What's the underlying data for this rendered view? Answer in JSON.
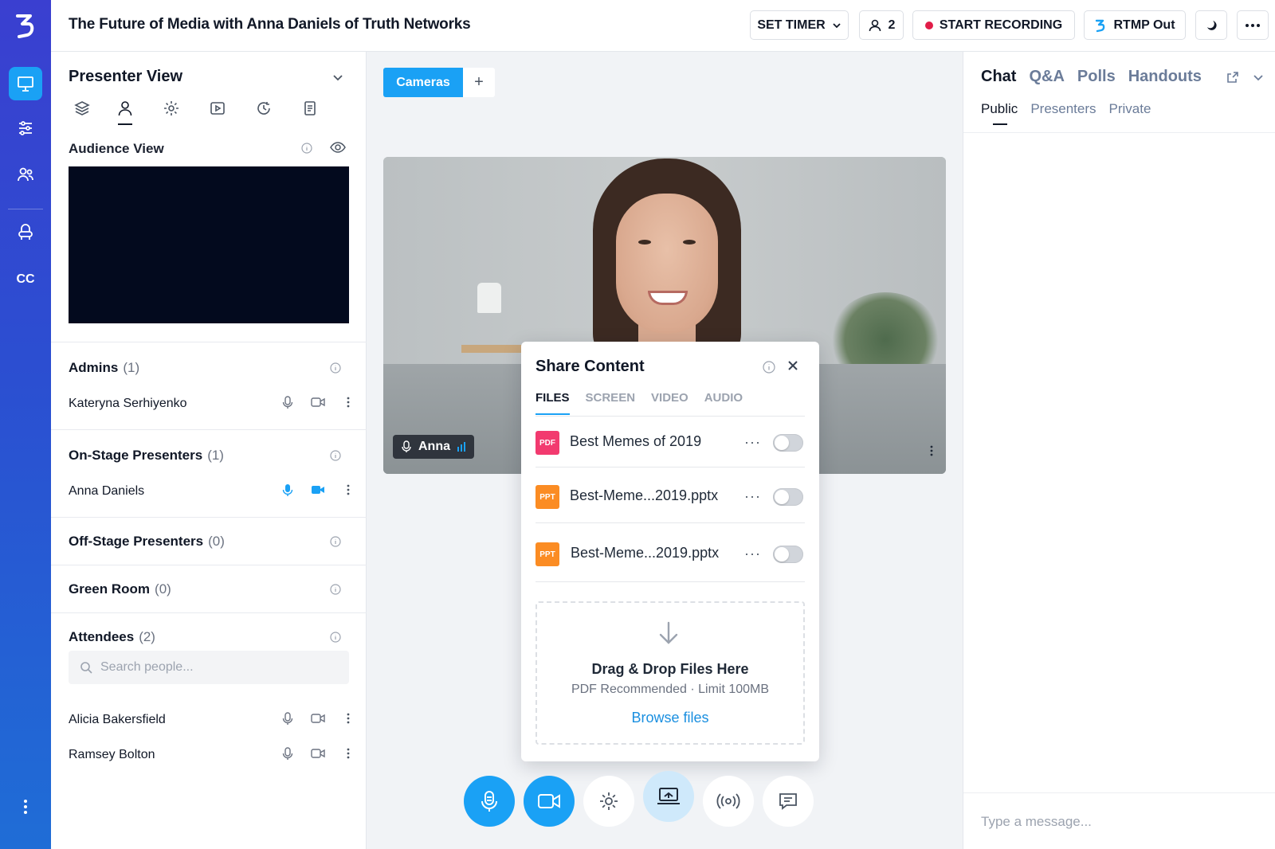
{
  "header": {
    "title": "The Future of Media with Anna Daniels of Truth Networks",
    "set_timer": "SET TIMER",
    "people_count": "2",
    "start_recording": "START RECORDING",
    "rtmp_out": "RTMP Out"
  },
  "rail": {
    "cc_label": "CC"
  },
  "left_panel": {
    "title": "Presenter View",
    "audience_view": "Audience View",
    "sections": [
      {
        "label": "Admins",
        "count": "(1)"
      },
      {
        "label": "On-Stage Presenters",
        "count": "(1)"
      },
      {
        "label": "Off-Stage Presenters",
        "count": "(0)"
      },
      {
        "label": "Green Room",
        "count": "(0)"
      },
      {
        "label": "Attendees",
        "count": "(2)"
      }
    ],
    "admins": [
      "Kateryna Serhiyenko"
    ],
    "on_stage": [
      "Anna Daniels"
    ],
    "attendees": [
      "Alicia Bakersfield",
      "Ramsey Bolton"
    ],
    "search_placeholder": "Search people..."
  },
  "stage": {
    "tab_cameras": "Cameras",
    "tab_add": "+",
    "presenter_name": "Anna"
  },
  "share": {
    "title": "Share Content",
    "tabs": [
      "FILES",
      "SCREEN",
      "VIDEO",
      "AUDIO"
    ],
    "files": [
      {
        "type": "PDF",
        "name": "Best Memes of 2019",
        "color": "#f23a6f"
      },
      {
        "type": "PPT",
        "name": "Best-Meme...2019.pptx",
        "color": "#fb8c23"
      },
      {
        "type": "PPT",
        "name": "Best-Meme...2019.pptx",
        "color": "#fb8c23"
      }
    ],
    "more": "···",
    "drop_title": "Drag & Drop Files Here",
    "drop_sub": "PDF Recommended · Limit 100MB",
    "browse": "Browse files"
  },
  "chat": {
    "tabs": [
      "Chat",
      "Q&A",
      "Polls",
      "Handouts"
    ],
    "subtabs": [
      "Public",
      "Presenters",
      "Private"
    ],
    "placeholder": "Type a message..."
  },
  "colors": {
    "accent": "#1aa1f5",
    "rail": "#2b4fd1",
    "record": "#e11d48"
  }
}
